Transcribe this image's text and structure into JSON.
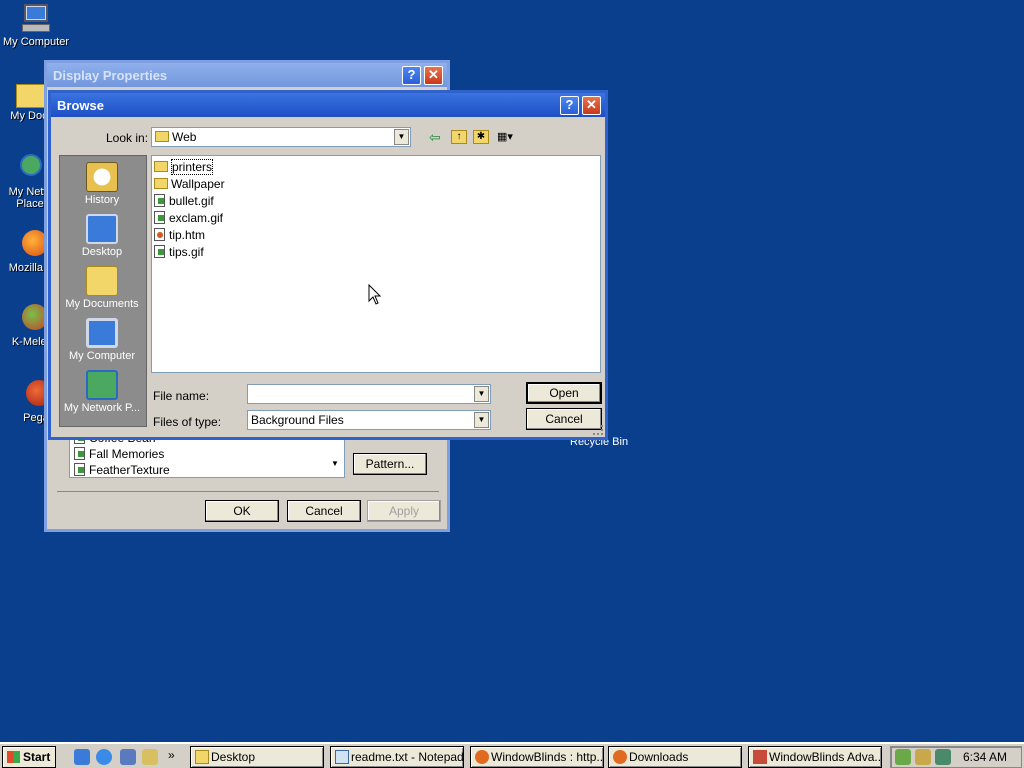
{
  "desktop": {
    "icons": [
      {
        "label": "My Computer"
      },
      {
        "label": "My Docu"
      },
      {
        "label": "My Netw Place"
      },
      {
        "label": "Mozilla Fi"
      },
      {
        "label": "K-Melec"
      },
      {
        "label": "Pega"
      }
    ],
    "recycle_bin": "Recycle Bin"
  },
  "display_properties": {
    "title": "Display Properties",
    "wallpaper_items": [
      "Coffee Bean",
      "Fall Memories",
      "FeatherTexture"
    ],
    "pattern_button": "Pattern...",
    "ok": "OK",
    "cancel": "Cancel",
    "apply": "Apply"
  },
  "browse": {
    "title": "Browse",
    "look_in_label": "Look in:",
    "look_in_value": "Web",
    "places": [
      {
        "label": "History",
        "icon": "history-icon"
      },
      {
        "label": "Desktop",
        "icon": "desktop-icon"
      },
      {
        "label": "My Documents",
        "icon": "my-documents-icon"
      },
      {
        "label": "My Computer",
        "icon": "my-computer-icon"
      },
      {
        "label": "My Network P...",
        "icon": "my-network-icon"
      }
    ],
    "files": [
      {
        "name": "printers",
        "type": "folder"
      },
      {
        "name": "Wallpaper",
        "type": "folder"
      },
      {
        "name": "bullet.gif",
        "type": "gif"
      },
      {
        "name": "exclam.gif",
        "type": "gif"
      },
      {
        "name": "tip.htm",
        "type": "htm"
      },
      {
        "name": "tips.gif",
        "type": "gif"
      }
    ],
    "file_name_label": "File name:",
    "file_name_value": "",
    "files_of_type_label": "Files of type:",
    "files_of_type_value": "Background Files",
    "open": "Open",
    "cancel": "Cancel"
  },
  "taskbar": {
    "start": "Start",
    "tasks": [
      "Desktop",
      "readme.txt - Notepad",
      "WindowBlinds : http...",
      "Downloads",
      "WindowBlinds Adva..."
    ],
    "clock": "6:34 AM"
  },
  "colors": {
    "desktop": "#0a3f8e",
    "title_active": "#1c4fc4",
    "places_bar": "#8c8c8c"
  }
}
